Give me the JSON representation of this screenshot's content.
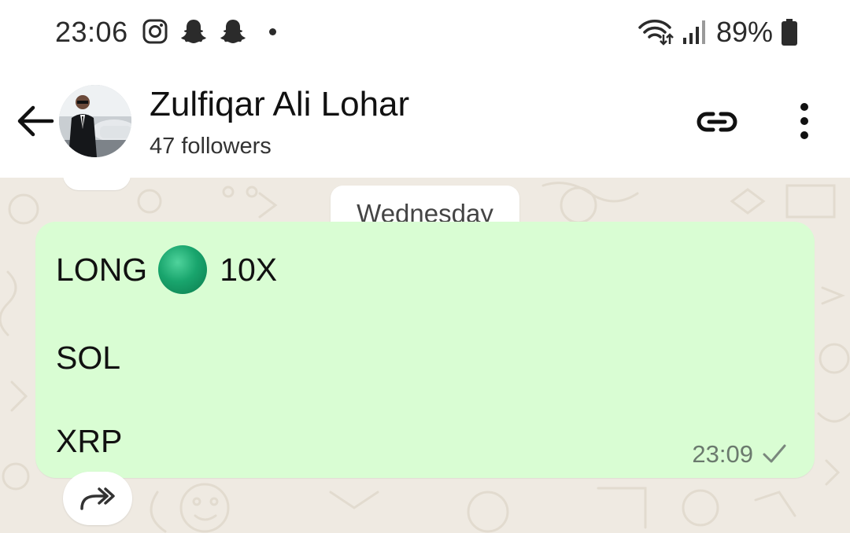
{
  "status_bar": {
    "time": "23:06",
    "battery": "89%",
    "left_icons": [
      "instagram-icon",
      "snapchat-icon",
      "snapchat-icon",
      "dot-icon"
    ],
    "right_icons": [
      "wifi-icon",
      "signal-icon",
      "battery-icon"
    ]
  },
  "header": {
    "channel_name": "Zulfiqar Ali Lohar",
    "followers": "47 followers",
    "icons": [
      "back-arrow-icon",
      "avatar",
      "link-icon",
      "more-vert-icon"
    ]
  },
  "chat": {
    "date_divider": "Wednesday",
    "message": {
      "line1_left": "LONG",
      "line1_right": "10X",
      "line2": "SOL",
      "line3": "XRP",
      "time": "23:09",
      "status_icon": "check-icon",
      "emoji": "green-circle"
    }
  },
  "colors": {
    "bubble": "#d9fdd3",
    "chat_background": "#efeae2",
    "header_background": "#ffffff"
  }
}
